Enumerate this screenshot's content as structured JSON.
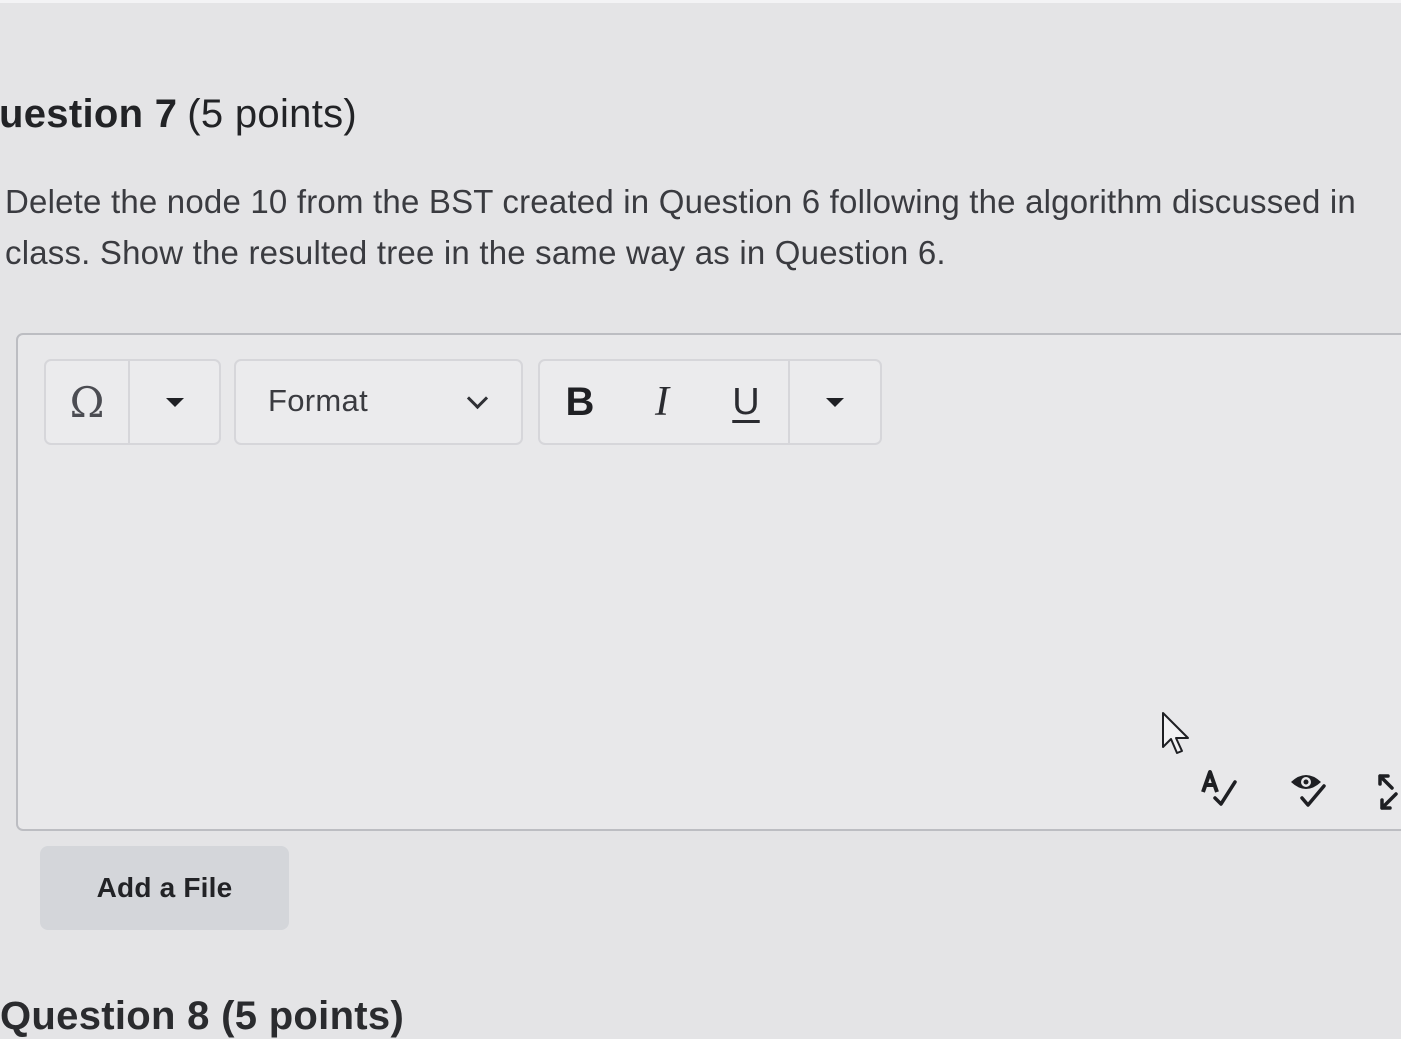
{
  "question": {
    "title": "uestion 7",
    "points": "(5 points)",
    "text_line1": "Delete the node 10 from the BST created in Question 6 following the algorithm discussed in",
    "text_line2": "class. Show the resulted tree in the same way as in Question 6."
  },
  "editor": {
    "toolbar": {
      "special_char_symbol": "Ω",
      "format_label": "Format",
      "bold_label": "B",
      "italic_label": "I",
      "underline_label": "U"
    },
    "body_text": "",
    "status_icons": [
      "spellcheck-icon",
      "accessibility-check-icon",
      "fullscreen-icon"
    ]
  },
  "add_file_label": "Add a File",
  "next_question_partial": "Question 8 (5 points)"
}
